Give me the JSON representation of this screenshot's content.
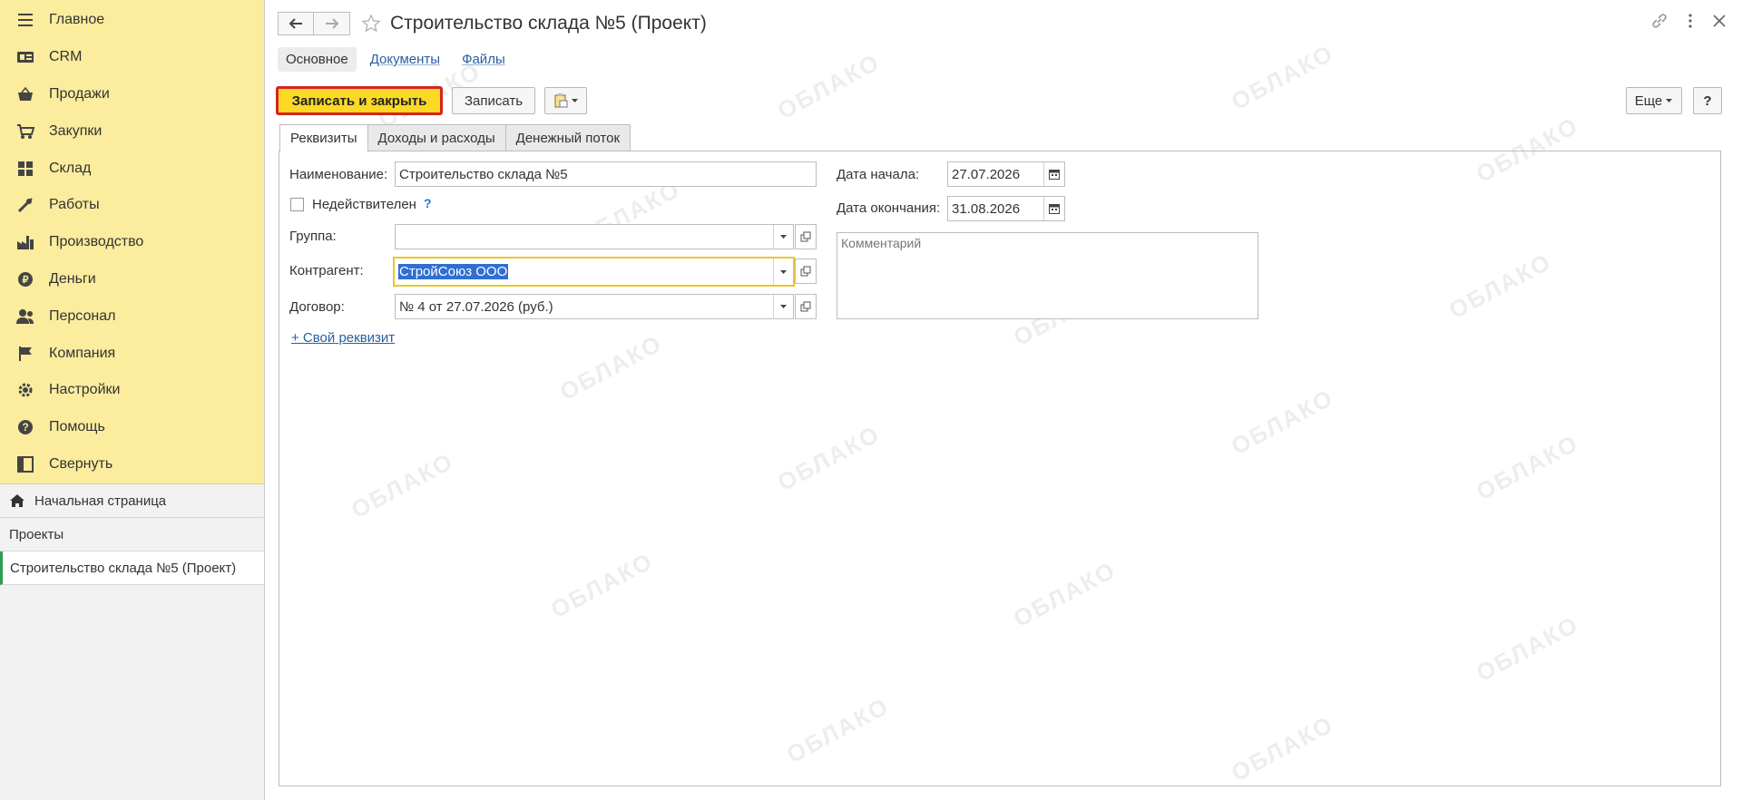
{
  "sidebar": {
    "menu": [
      {
        "label": "Главное",
        "icon": "menu-lines-icon"
      },
      {
        "label": "CRM",
        "icon": "crm-icon"
      },
      {
        "label": "Продажи",
        "icon": "basket-icon"
      },
      {
        "label": "Закупки",
        "icon": "cart-icon"
      },
      {
        "label": "Склад",
        "icon": "warehouse-icon"
      },
      {
        "label": "Работы",
        "icon": "tools-icon"
      },
      {
        "label": "Производство",
        "icon": "factory-icon"
      },
      {
        "label": "Деньги",
        "icon": "money-icon"
      },
      {
        "label": "Персонал",
        "icon": "people-icon"
      },
      {
        "label": "Компания",
        "icon": "flag-icon"
      },
      {
        "label": "Настройки",
        "icon": "gear-icon"
      },
      {
        "label": "Помощь",
        "icon": "help-icon"
      },
      {
        "label": "Свернуть",
        "icon": "collapse-icon"
      }
    ],
    "open": {
      "home": "Начальная страница",
      "projects": "Проекты",
      "current": "Строительство склада №5 (Проект)"
    }
  },
  "header": {
    "title": "Строительство склада №5 (Проект)"
  },
  "section_tabs": [
    "Основное",
    "Документы",
    "Файлы"
  ],
  "toolbar": {
    "save_close": "Записать и закрыть",
    "save": "Записать",
    "more": "Еще",
    "help": "?"
  },
  "form_tabs": [
    "Реквизиты",
    "Доходы и расходы",
    "Денежный поток"
  ],
  "form": {
    "name_label": "Наименование:",
    "name_value": "Строительство склада №5",
    "inactive_label": "Недействителен",
    "inactive_help": "?",
    "group_label": "Группа:",
    "group_value": "",
    "counterparty_label": "Контрагент:",
    "counterparty_value": "СтройСоюз ООО",
    "contract_label": "Договор:",
    "contract_value": "№ 4 от 27.07.2026 (руб.)",
    "add_attr": "+ Свой реквизит",
    "start_label": "Дата начала:",
    "start_value": "27.07.2026",
    "end_label": "Дата окончания:",
    "end_value": "31.08.2026",
    "comment_placeholder": "Комментарий"
  },
  "watermark": "ОБЛАКО"
}
